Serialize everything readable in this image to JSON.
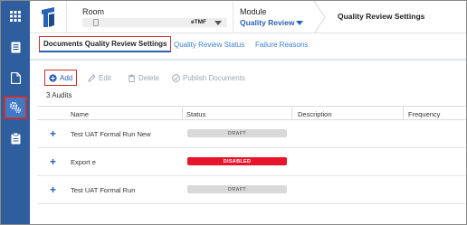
{
  "header": {
    "room_label": "Room",
    "room_tag": "eTMF",
    "module_label": "Module",
    "module_value": "Quality Review",
    "page_title": "Quality Review Settings"
  },
  "tabs": [
    {
      "label": "Documents Quality Review Settings",
      "active": true
    },
    {
      "label": "Quality Review Status",
      "active": false
    },
    {
      "label": "Failure Reasons",
      "active": false
    }
  ],
  "toolbar": {
    "add_label": "Add",
    "edit_label": "Edit",
    "delete_label": "Delete",
    "publish_label": "Publish Documents"
  },
  "audits_count": "3 Audits",
  "table": {
    "columns": [
      "Name",
      "Status",
      "Description",
      "Frequency"
    ],
    "rows": [
      {
        "name": "Test UAT Formal Run New",
        "status": "DRAFT",
        "status_kind": "draft"
      },
      {
        "name": "Export e",
        "status": "DISABLED",
        "status_kind": "disabled"
      },
      {
        "name": "Test UAT Formal Run",
        "status": "DRAFT",
        "status_kind": "draft"
      }
    ]
  },
  "colors": {
    "rail": "#2f5e9e",
    "accent": "#2a62b5",
    "link": "#3b83d6",
    "highlight_border": "#c8302c",
    "disabled_badge": "#e8142b",
    "draft_badge": "#d9d9d9"
  },
  "icons": {
    "rail": [
      "apps-grid-icon",
      "document-list-icon",
      "document-icon",
      "settings-gears-icon",
      "clipboard-icon"
    ],
    "toolbar": [
      "add-circle-icon",
      "edit-pencil-icon",
      "trash-icon",
      "publish-check-icon"
    ]
  }
}
